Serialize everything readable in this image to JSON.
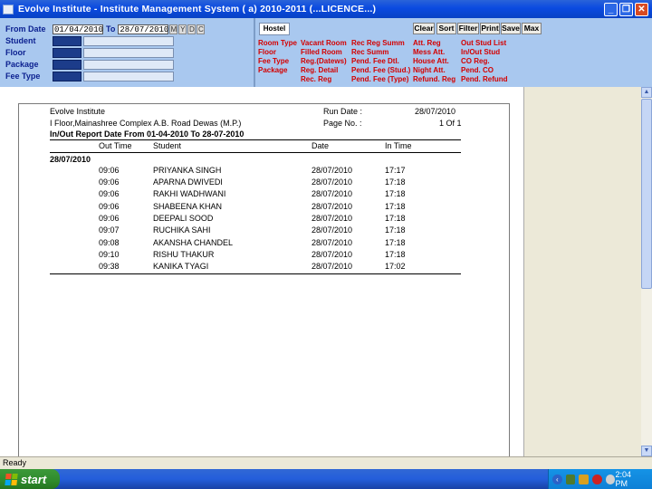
{
  "window": {
    "title": "Evolve Institute - Institute Management System ( a) 2010-2011 (...LICENCE...)"
  },
  "filters": {
    "from_date_label": "From Date",
    "from_date_value": "01/04/2010",
    "to_label": "To",
    "to_date_value": "28/07/2010",
    "ymd": [
      "M",
      "Y",
      "D",
      "C"
    ],
    "fields": [
      "Student",
      "Floor",
      "Package",
      "Fee Type"
    ]
  },
  "menu": {
    "tab": "Hostel",
    "buttons": [
      "Clear",
      "Sort",
      "Filter",
      "Print",
      "Save",
      "Max"
    ],
    "columns": [
      [
        "Room Type",
        "Floor",
        "Fee Type",
        "Package"
      ],
      [
        "Vacant Room",
        "Filled Room",
        "Reg.(Datews)",
        "Reg. Detail",
        "Rec. Reg"
      ],
      [
        "Rec Reg Summ",
        "Rec Summ",
        "Pend. Fee Dtl.",
        "Pend. Fee (Stud.)",
        "Pend. Fee (Type)"
      ],
      [
        "Att. Reg",
        "Mess Att.",
        "House Att.",
        "Night Att.",
        "Refund. Reg"
      ],
      [
        "Out Stud List",
        "In/Out Stud",
        "CO Reg.",
        "Pend. CO",
        "Pend. Refund"
      ]
    ]
  },
  "report": {
    "institute": "Evolve Institute",
    "address": "I Floor,Mainashree Complex A.B. Road Dewas (M.P.)",
    "run_date_label": "Run Date :",
    "run_date": "28/07/2010",
    "page_no_label": "Page No. :",
    "page_no": "1 Of 1",
    "title": "In/Out Report Date From 01-04-2010 To 28-07-2010",
    "columns": {
      "out_time": "Out Time",
      "student": "Student",
      "date": "Date",
      "in_time": "In Time"
    },
    "group_date": "28/07/2010",
    "rows": [
      {
        "out": "09:06",
        "student": "PRIYANKA SINGH",
        "date": "28/07/2010",
        "in": "17:17"
      },
      {
        "out": "09:06",
        "student": "APARNA  DWIVEDI",
        "date": "28/07/2010",
        "in": "17:18"
      },
      {
        "out": "09:06",
        "student": "RAKHI WADHWANI",
        "date": "28/07/2010",
        "in": "17:18"
      },
      {
        "out": "09:06",
        "student": "SHABEENA KHAN",
        "date": "28/07/2010",
        "in": "17:18"
      },
      {
        "out": "09:06",
        "student": "DEEPALI  SOOD",
        "date": "28/07/2010",
        "in": "17:18"
      },
      {
        "out": "09:07",
        "student": "RUCHIKA  SAHI",
        "date": "28/07/2010",
        "in": "17:18"
      },
      {
        "out": "09:08",
        "student": "AKANSHA CHANDEL",
        "date": "28/07/2010",
        "in": "17:18"
      },
      {
        "out": "09:10",
        "student": "RISHU  THAKUR",
        "date": "28/07/2010",
        "in": "17:18"
      },
      {
        "out": "09:38",
        "student": "KANIKA  TYAGI",
        "date": "28/07/2010",
        "in": "17:02"
      }
    ]
  },
  "status": {
    "text": "Ready"
  },
  "taskbar": {
    "start_label": "start",
    "time": "2:04 PM"
  },
  "colors": {
    "title_bar": "#0a4ae0",
    "panel_bg": "#a9c8ef",
    "menu_text": "#d40000",
    "label_text": "#0a1f8f",
    "taskbar": "#245edb",
    "start_button": "#2e8a2c"
  }
}
